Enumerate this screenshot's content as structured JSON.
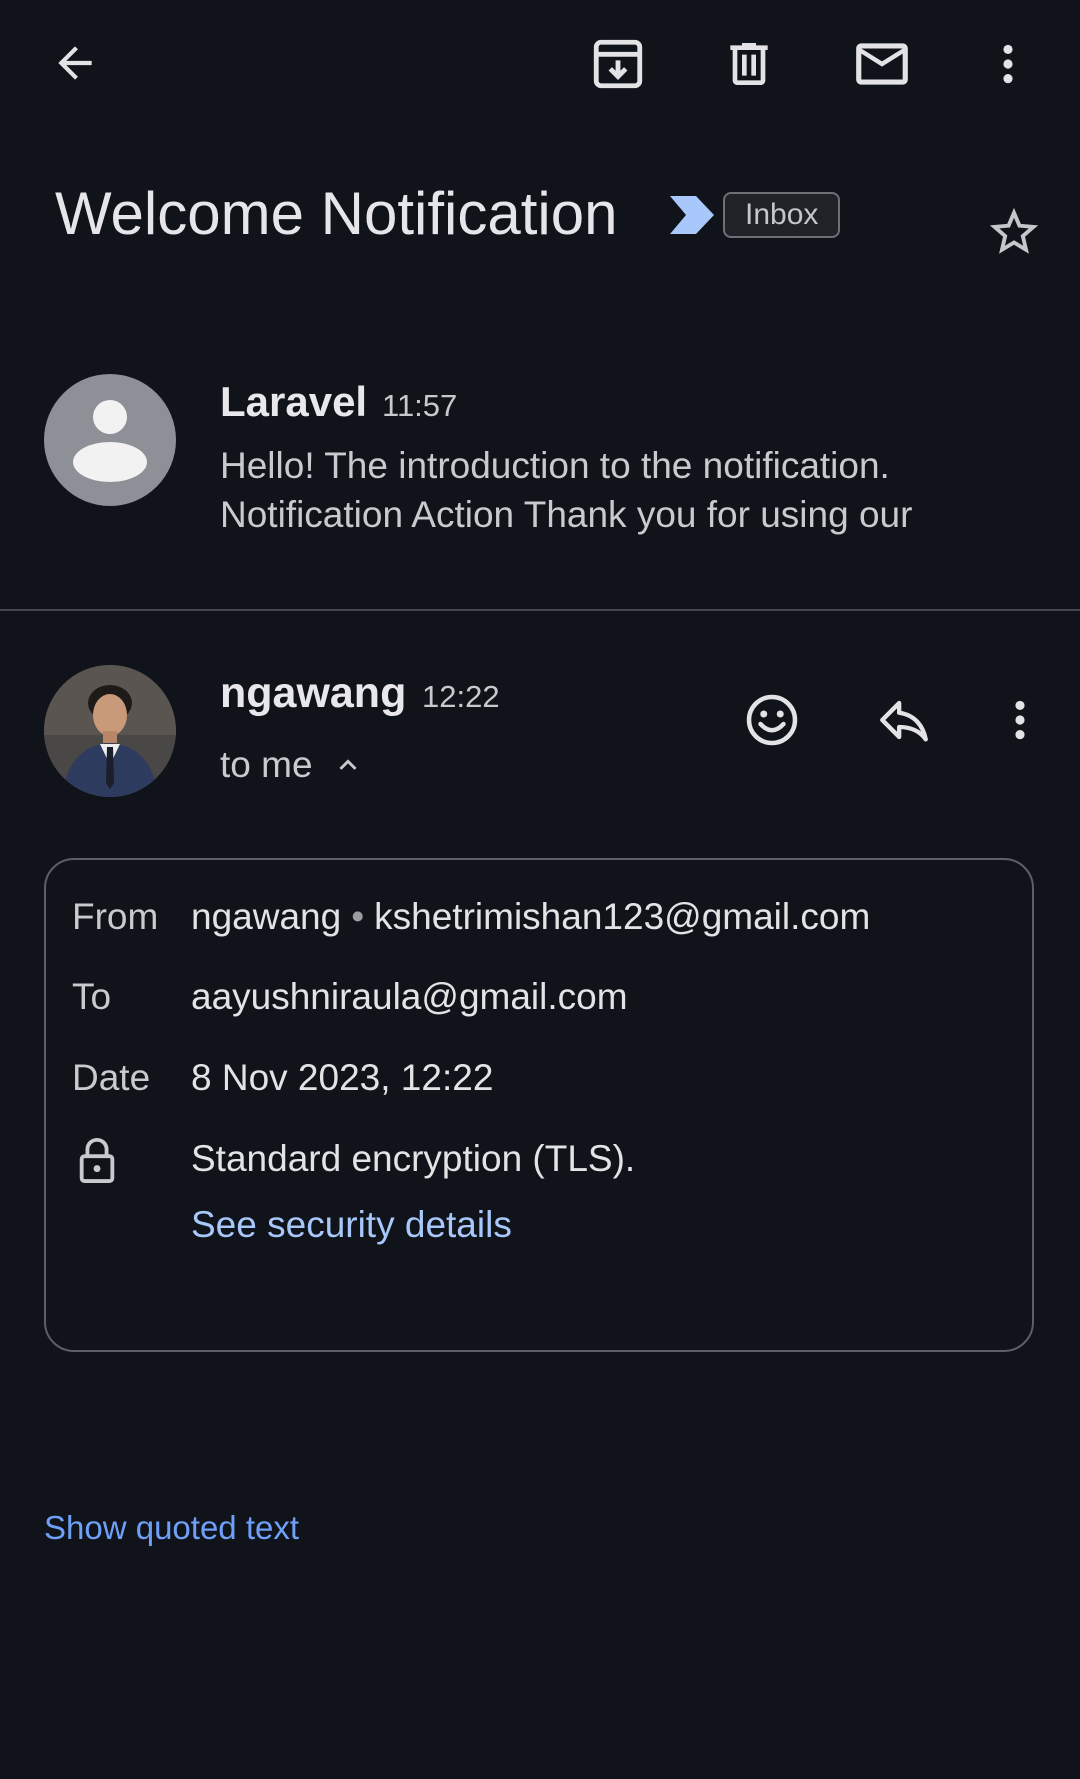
{
  "toolbar": {
    "back_icon": "arrow-back-icon",
    "archive_icon": "archive-icon",
    "delete_icon": "delete-icon",
    "mark_unread_icon": "mail-icon",
    "more_icon": "more-vert-icon"
  },
  "subject": {
    "title": "Welcome Notification",
    "label": "Inbox",
    "importance_color": "#a8c7fa",
    "star_icon": "star-outline-icon"
  },
  "messages": [
    {
      "sender": "Laravel",
      "time": "11:57",
      "snippet": "Hello! The introduction to the notification. Notification Action Thank you for using our"
    },
    {
      "sender": "ngawang",
      "time": "12:22",
      "recipient_summary": "to me",
      "actions": [
        "emoji-icon",
        "reply-icon",
        "more-vert-icon"
      ]
    }
  ],
  "details": {
    "from_label": "From",
    "from_name": "ngawang",
    "from_email": "kshetrimishan123@gmail.com",
    "to_label": "To",
    "to_value": "aayushniraula@gmail.com",
    "date_label": "Date",
    "date_value": "8 Nov 2023, 12:22",
    "encryption_text": "Standard encryption (TLS).",
    "security_link": "See security details"
  },
  "show_quoted_text": "Show quoted text",
  "colors": {
    "background": "#11131a",
    "link": "#a8c7fa",
    "link_secondary": "#6ea0f7"
  }
}
